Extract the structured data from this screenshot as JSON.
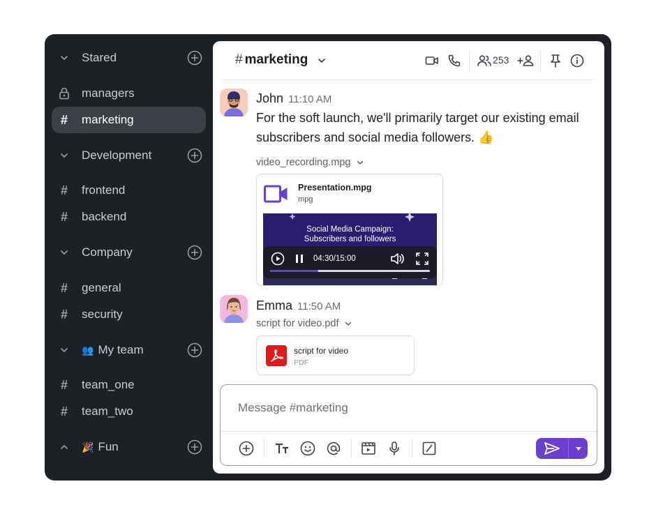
{
  "sidebar": {
    "groups": [
      {
        "name": "Stared",
        "emoji": ""
      },
      {
        "name": "Development",
        "emoji": ""
      },
      {
        "name": "Company",
        "emoji": ""
      },
      {
        "name": "My team",
        "emoji": "👥"
      },
      {
        "name": "Fun",
        "emoji": "🎉"
      }
    ],
    "items": [
      {
        "label": "managers",
        "icon": "lock-icon"
      },
      {
        "label": "marketing",
        "icon": "hash-icon"
      },
      {
        "label": "frontend",
        "icon": "hash-icon"
      },
      {
        "label": "backend",
        "icon": "hash-icon"
      },
      {
        "label": "general",
        "icon": "hash-icon"
      },
      {
        "label": "security",
        "icon": "hash-icon"
      },
      {
        "label": "team_one",
        "icon": "hash-icon"
      },
      {
        "label": "team_two",
        "icon": "hash-icon"
      }
    ],
    "hash_symbol": "#"
  },
  "header": {
    "hash": "#",
    "channel": "marketing",
    "member_count": "253"
  },
  "messages": [
    {
      "author": "John",
      "time": "11:10 AM",
      "text": "For the soft launch, we'll primarily target our existing email subscribers and social media followers. 👍",
      "attachment_name": "video_recording.mpg",
      "card_title": "Presentation.mpg",
      "card_sub": "mpg",
      "video_title_line1": "Social Media Campaign:",
      "video_title_line2": "Subscribers and followers",
      "video_time": "04:30/15:00",
      "video_progress": 0.3
    },
    {
      "author": "Emma",
      "time": "11:50 AM",
      "attachment_name": "script for video.pdf",
      "card_title": "script for video",
      "card_sub": "PDF"
    }
  ],
  "composer": {
    "placeholder": "Message #marketing"
  },
  "colors": {
    "accent": "#6a3fd1",
    "sidebar_bg": "#1d2125",
    "active_item": "#3b4046",
    "pdf_red": "#e01b1b"
  }
}
